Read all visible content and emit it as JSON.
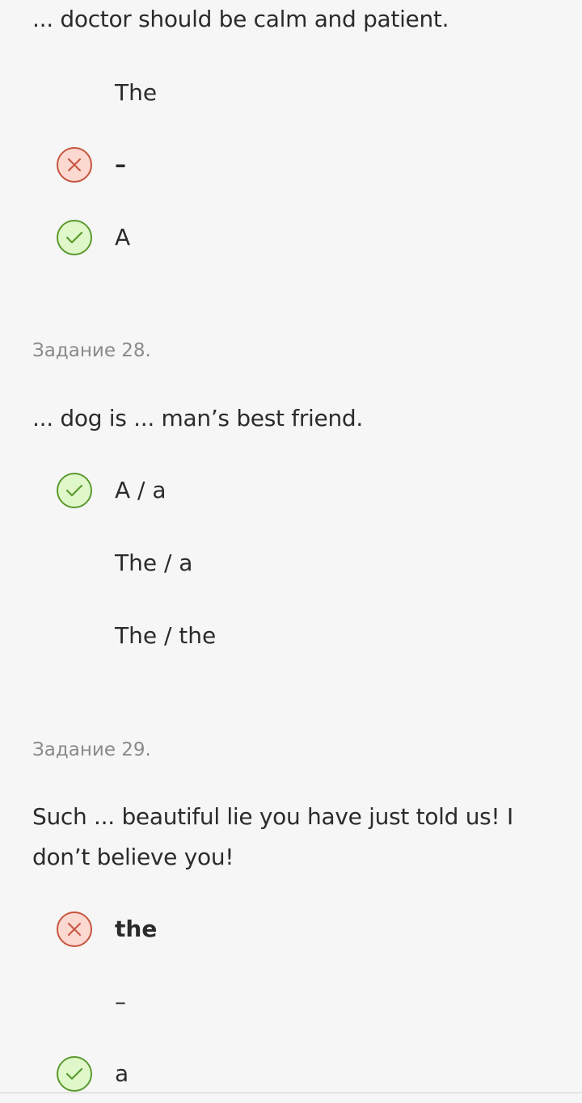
{
  "q27": {
    "question": "... doctor should be calm and patient.",
    "options": [
      {
        "text": "The",
        "status": "none"
      },
      {
        "text": "–",
        "status": "wrong"
      },
      {
        "text": "A",
        "status": "correct"
      }
    ]
  },
  "q28": {
    "label": "Задание 28.",
    "question": "... dog is ... man’s best friend.",
    "options": [
      {
        "text": "A / a",
        "status": "correct"
      },
      {
        "text": "The / a",
        "status": "none"
      },
      {
        "text": "The / the",
        "status": "none"
      }
    ]
  },
  "q29": {
    "label": "Задание 29.",
    "question": "Such ... beautiful lie you have just told us! I don’t believe you!",
    "options": [
      {
        "text": "the",
        "status": "wrong",
        "selected": true
      },
      {
        "text": "–",
        "status": "none"
      },
      {
        "text": "a",
        "status": "correct"
      }
    ]
  },
  "icons": {
    "correct": "check-icon",
    "wrong": "cross-icon"
  },
  "colors": {
    "correct_fill": "#dff7c9",
    "correct_border": "#5a9a2e",
    "wrong_fill": "#fbd8d0",
    "wrong_border": "#c6553f",
    "background": "#f6f6f6",
    "label_gray": "#8a8a8a"
  }
}
